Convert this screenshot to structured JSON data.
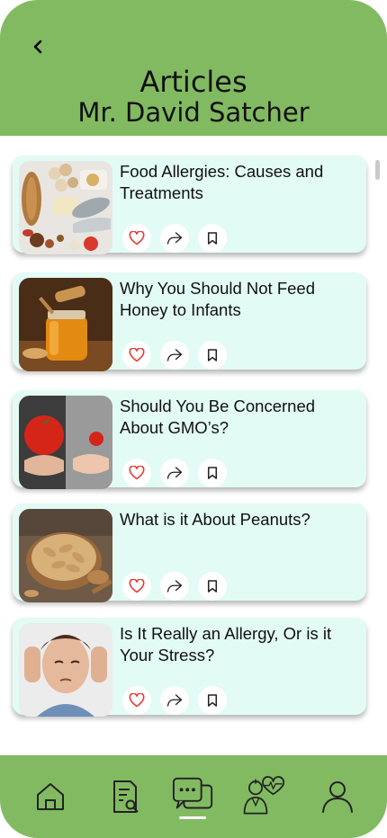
{
  "header": {
    "title": "Articles",
    "subtitle": "Mr. David Satcher",
    "background_color": "#82ba62",
    "back_icon": "chevron-left-icon"
  },
  "articles": [
    {
      "title": "Food Allergies: Causes and Treatments",
      "image": "allergen-foods-photo"
    },
    {
      "title": "Why You Should Not Feed Honey to Infants",
      "image": "honey-jar-photo"
    },
    {
      "title": "Should You Be Concerned About GMO’s?",
      "image": "tomatoes-in-hands-photo"
    },
    {
      "title": "What is it About Peanuts?",
      "image": "peanuts-bowl-photo"
    },
    {
      "title": "Is It Really an Allergy, Or is it Your Stress?",
      "image": "stressed-woman-photo"
    }
  ],
  "card_actions": [
    "heart-icon",
    "share-icon",
    "bookmark-icon"
  ],
  "card_color": "#e2fbf5",
  "heart_color": "#e53935",
  "bottom_nav": {
    "items": [
      "home-icon",
      "articles-search-icon",
      "chat-icon",
      "doctor-heart-icon",
      "profile-icon"
    ],
    "active": "chat-icon"
  }
}
